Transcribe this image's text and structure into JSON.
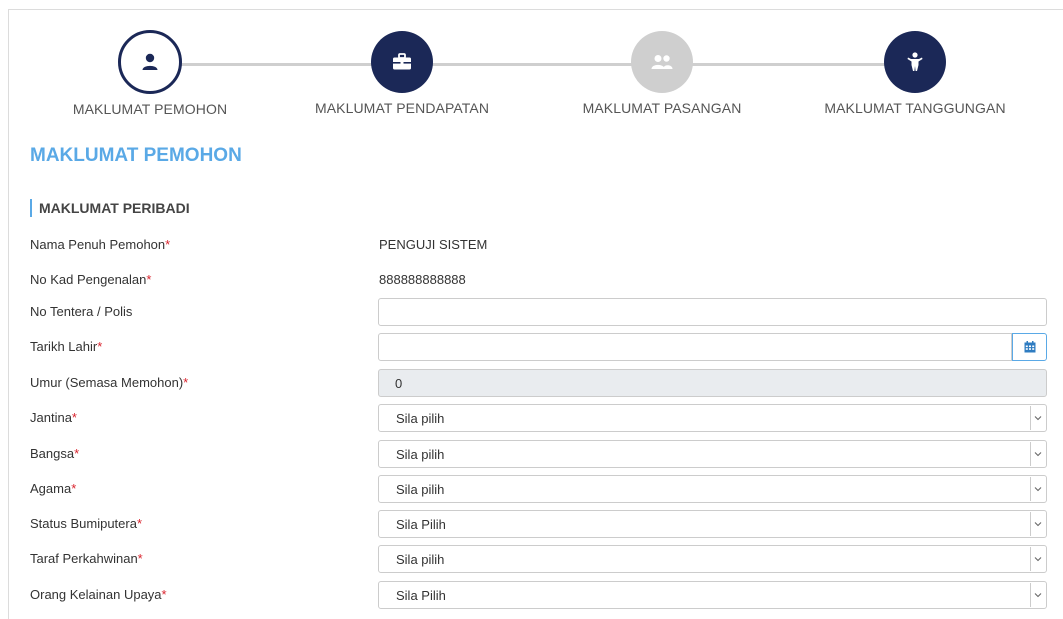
{
  "stepper": {
    "steps": [
      {
        "label": "MAKLUMAT PEMOHON",
        "state": "current",
        "icon": "user-icon"
      },
      {
        "label": "MAKLUMAT PENDAPATAN",
        "state": "done",
        "icon": "briefcase-icon"
      },
      {
        "label": "MAKLUMAT PASANGAN",
        "state": "todo",
        "icon": "users-icon"
      },
      {
        "label": "MAKLUMAT TANGGUNGAN",
        "state": "done",
        "icon": "child-icon"
      }
    ],
    "colors": {
      "active": "#1b2857",
      "inactive": "#cfcfcf",
      "accent": "#5aa9e6"
    }
  },
  "section_title": "MAKLUMAT PEMOHON",
  "sub_title": "MAKLUMAT PERIBADI",
  "fields": {
    "nama": {
      "label": "Nama Penuh Pemohon",
      "value": "PENGUJI SISTEM"
    },
    "kad": {
      "label": "No Kad Pengenalan",
      "value": "888888888888"
    },
    "tentera": {
      "label": "No Tentera / Polis",
      "value": ""
    },
    "lahir": {
      "label": "Tarikh Lahir",
      "value": ""
    },
    "umur": {
      "label": "Umur (Semasa Memohon)",
      "value": "0"
    },
    "jantina": {
      "label": "Jantina",
      "value": "Sila pilih"
    },
    "bangsa": {
      "label": "Bangsa",
      "value": "Sila pilih"
    },
    "agama": {
      "label": "Agama",
      "value": "Sila pilih"
    },
    "bumiputera": {
      "label": "Status Bumiputera",
      "value": "Sila Pilih"
    },
    "perkahwinan": {
      "label": "Taraf Perkahwinan",
      "value": "Sila pilih"
    },
    "kelainan": {
      "label": "Orang Kelainan Upaya",
      "value": "Sila Pilih"
    }
  },
  "required_mark": "*"
}
